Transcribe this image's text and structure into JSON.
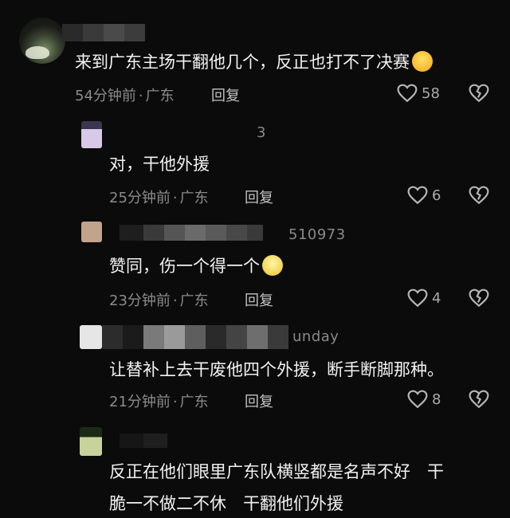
{
  "comments": [
    {
      "name_tail": "",
      "text": "来到广东主场干翻他几个，反正也打不了决赛",
      "time": "54分钟前",
      "location": "广东",
      "reply_label": "回复",
      "likes": "58",
      "emoji": "laughing-tears-emoji"
    },
    {
      "name_tail": "3",
      "text": "对，干他外援",
      "time": "25分钟前",
      "location": "广东",
      "reply_label": "回复",
      "likes": "6"
    },
    {
      "name_tail": "510973",
      "text": "赞同，伤一个得一个",
      "time": "23分钟前",
      "location": "广东",
      "reply_label": "回复",
      "likes": "4",
      "emoji": "smile-emoji"
    },
    {
      "name_tail": "unday",
      "text": "让替补上去干废他四个外援，断手断脚那种。",
      "time": "21分钟前",
      "location": "广东",
      "reply_label": "回复",
      "likes": "8"
    },
    {
      "name_tail": "",
      "text_line1": "反正在他们眼里广东队横竖都是名声不好　干",
      "text_line2": "脆一不做二不休　干翻他们外援"
    }
  ],
  "separator": "·",
  "colors": {
    "background": "#0b0b0b",
    "text": "#f2f2f2",
    "meta": "#8b8b8b",
    "icon": "#b5b5b5"
  }
}
